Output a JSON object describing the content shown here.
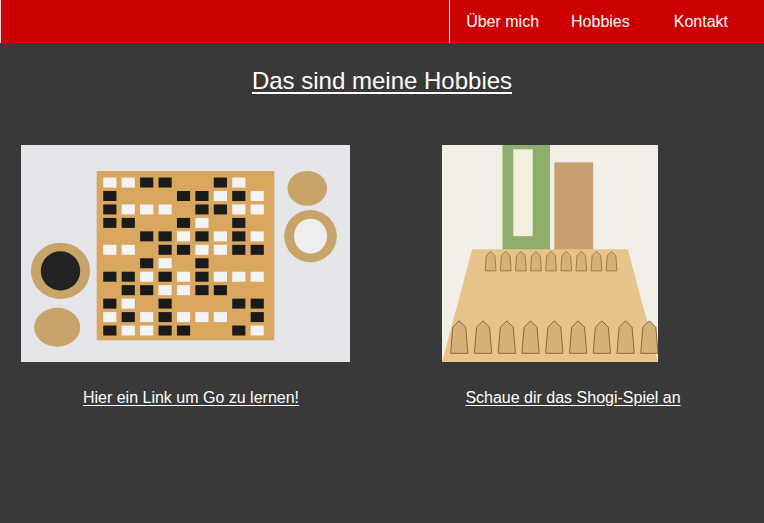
{
  "nav": {
    "items": [
      {
        "label": "Über mich"
      },
      {
        "label": "Hobbies"
      },
      {
        "label": "Kontakt"
      }
    ]
  },
  "title": "Das sind meine Hobbies",
  "hobbies": [
    {
      "kind": "go",
      "link": "Hier ein Link um Go zu lernen!"
    },
    {
      "kind": "shogi",
      "link": "Schaue dir das Shogi-Spiel an"
    }
  ]
}
